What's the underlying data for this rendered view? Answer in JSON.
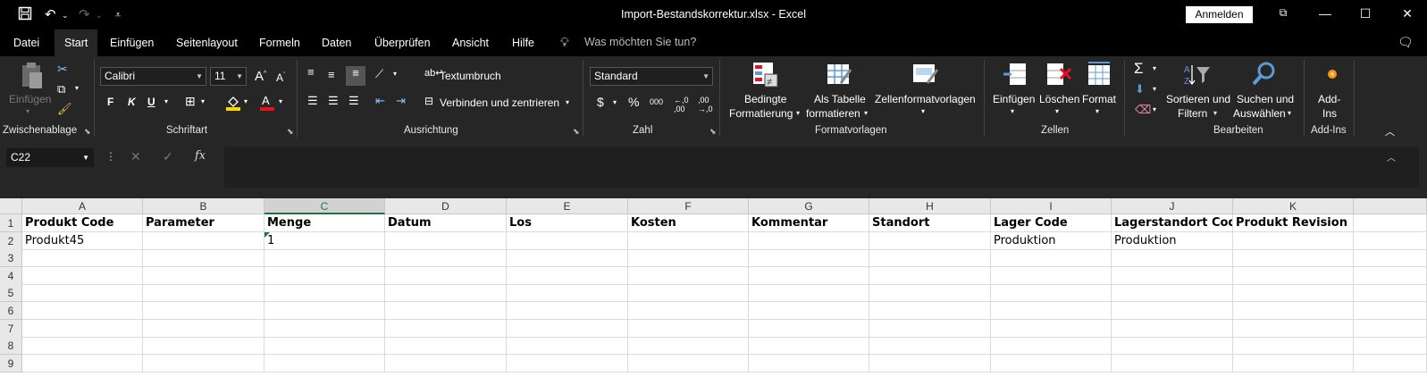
{
  "window": {
    "title": "Import-Bestandskorrektur.xlsx  -  Excel",
    "signin_label": "Anmelden"
  },
  "menu": {
    "tabs": [
      "Datei",
      "Start",
      "Einfügen",
      "Seitenlayout",
      "Formeln",
      "Daten",
      "Überprüfen",
      "Ansicht",
      "Hilfe"
    ],
    "active_tab": "Start",
    "tell_me_placeholder": "Was möchten Sie tun?"
  },
  "ribbon": {
    "clipboard": {
      "group_label": "Zwischenablage",
      "paste_label": "Einfügen"
    },
    "font": {
      "group_label": "Schriftart",
      "font_name": "Calibri",
      "font_size": "11",
      "bold": "F",
      "italic": "K",
      "underline": "U"
    },
    "alignment": {
      "group_label": "Ausrichtung",
      "wrap_text": "Textumbruch",
      "merge_center": "Verbinden und zentrieren"
    },
    "number": {
      "group_label": "Zahl",
      "format": "Standard",
      "currency": "$",
      "percent": "%",
      "thousands": "000"
    },
    "styles": {
      "group_label": "Formatvorlagen",
      "conditional_line1": "Bedingte",
      "conditional_line2": "Formatierung",
      "table_line1": "Als Tabelle",
      "table_line2": "formatieren",
      "cell_styles": "Zellenformatvorlagen"
    },
    "cells": {
      "group_label": "Zellen",
      "insert": "Einfügen",
      "delete": "Löschen",
      "format": "Format"
    },
    "editing": {
      "group_label": "Bearbeiten",
      "sort_line1": "Sortieren und",
      "sort_line2": "Filtern",
      "find_line1": "Suchen und",
      "find_line2": "Auswählen"
    },
    "addins": {
      "group_label": "Add-Ins",
      "line1": "Add-",
      "line2": "Ins"
    }
  },
  "formula_bar": {
    "name_box": "C22",
    "formula": ""
  },
  "sheet": {
    "columns": [
      "A",
      "B",
      "C",
      "D",
      "E",
      "F",
      "G",
      "H",
      "I",
      "J",
      "K"
    ],
    "selected_column": "C",
    "row_numbers": [
      "1",
      "2",
      "3",
      "4",
      "5",
      "6",
      "7",
      "8",
      "9"
    ],
    "rows": [
      [
        "Produkt Code",
        "Parameter",
        "Menge",
        "Datum",
        "Los",
        "Kosten",
        "Kommentar",
        "Standort",
        "Lager Code",
        "Lagerstandort Code",
        "Produkt Revision"
      ],
      [
        "Produkt45",
        "",
        "1",
        "",
        "",
        "",
        "",
        "",
        "Produktion",
        "Produktion",
        ""
      ],
      [
        "",
        "",
        "",
        "",
        "",
        "",
        "",
        "",
        "",
        "",
        ""
      ],
      [
        "",
        "",
        "",
        "",
        "",
        "",
        "",
        "",
        "",
        "",
        ""
      ],
      [
        "",
        "",
        "",
        "",
        "",
        "",
        "",
        "",
        "",
        "",
        ""
      ],
      [
        "",
        "",
        "",
        "",
        "",
        "",
        "",
        "",
        "",
        "",
        ""
      ],
      [
        "",
        "",
        "",
        "",
        "",
        "",
        "",
        "",
        "",
        "",
        ""
      ],
      [
        "",
        "",
        "",
        "",
        "",
        "",
        "",
        "",
        "",
        "",
        ""
      ],
      [
        "",
        "",
        "",
        "",
        "",
        "",
        "",
        "",
        "",
        "",
        ""
      ]
    ]
  },
  "colors": {
    "accent_green": "#217346",
    "ribbon_bg": "#262626",
    "title_bg": "#000000"
  }
}
